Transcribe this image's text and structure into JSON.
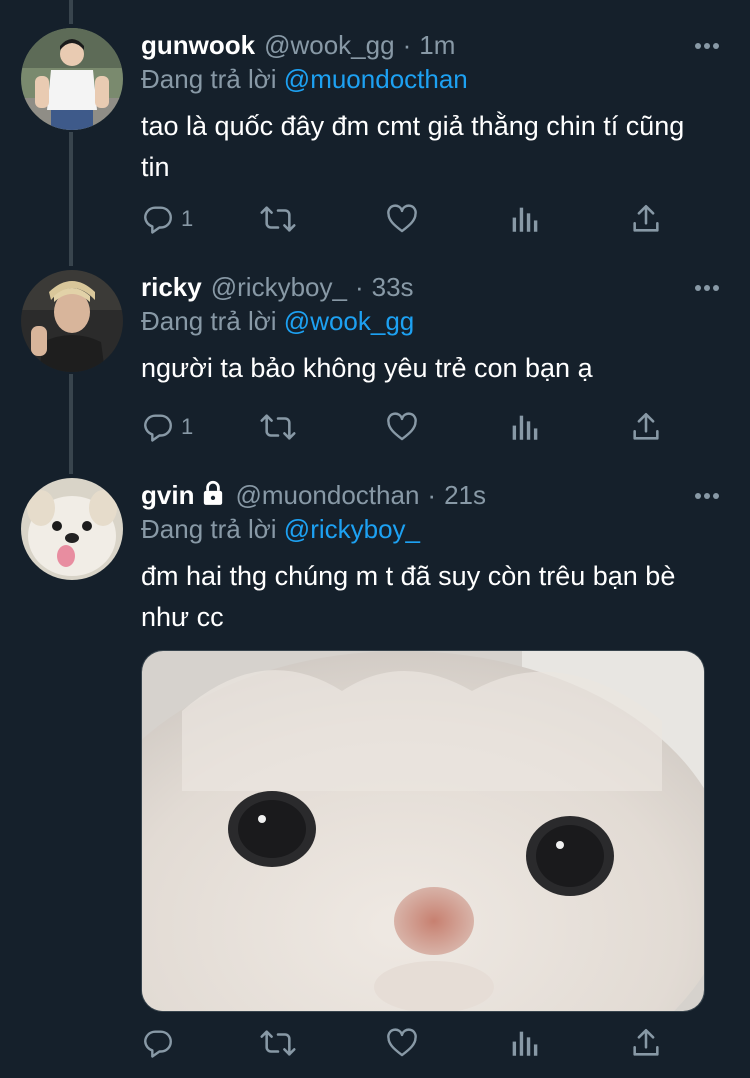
{
  "tweets": [
    {
      "name": "gunwook",
      "handle": "@wook_gg",
      "time": "1m",
      "replying_label": "Đang trả lời",
      "replying_to": "@muondocthan",
      "text": "tao là quốc đây đm cmt giả thằng chin tí cũng tin",
      "reply_count": "1"
    },
    {
      "name": "ricky",
      "handle": "@rickyboy_",
      "time": "33s",
      "replying_label": "Đang trả lời",
      "replying_to": "@wook_gg",
      "text": "người ta bảo không yêu trẻ con bạn ạ",
      "reply_count": "1"
    },
    {
      "name": "gvin",
      "handle": "@muondocthan",
      "time": "21s",
      "replying_label": "Đang trả lời",
      "replying_to": "@rickyboy_",
      "text": "đm hai thg chúng m t đã suy còn trêu bạn bè như cc",
      "reply_count": ""
    }
  ],
  "separator": "·",
  "icons": {
    "reply": "reply-icon",
    "retweet": "retweet-icon",
    "like": "like-icon",
    "analytics": "analytics-icon",
    "share": "share-icon",
    "more": "more-icon",
    "lock": "lock-icon"
  },
  "colors": {
    "background": "#15202b",
    "secondary_text": "#8899a6",
    "accent": "#1da1f2",
    "thread_line": "#38444d"
  }
}
